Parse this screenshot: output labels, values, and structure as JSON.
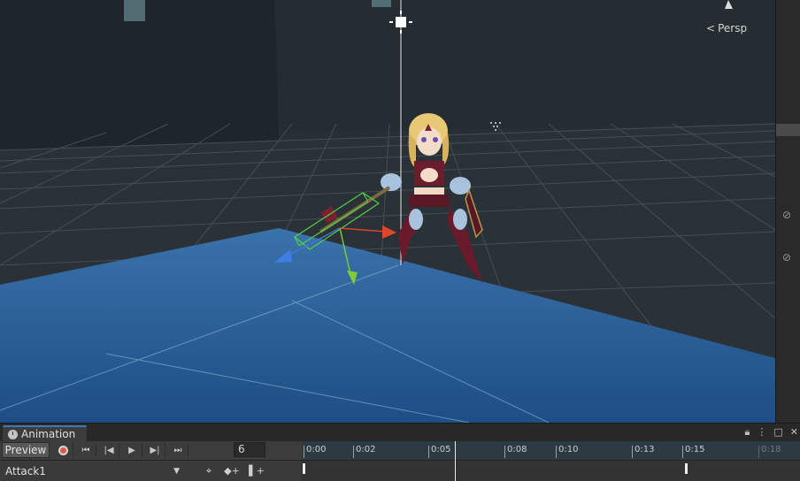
{
  "scene": {
    "camera_mode": "Persp",
    "icons": [
      "light-icon",
      "bone-gizmo-icon",
      "hand-icon"
    ]
  },
  "right_panel": {
    "icons": [
      "visibility-off-icon",
      "visibility-off-icon"
    ]
  },
  "animation": {
    "tab_label": "Animation",
    "window_icons": [
      "lock-icon",
      "menu-dots-icon",
      "maximize-icon",
      "close-icon"
    ],
    "toolbar": {
      "preview_label": "Preview",
      "buttons": [
        "record-button",
        "first-key-button",
        "prev-key-button",
        "play-button",
        "next-key-button",
        "last-key-button"
      ],
      "frame_value": "6"
    },
    "clip_name": "Attack1",
    "row_buttons": [
      "add-keyframe-filter-button",
      "add-keyframe-button",
      "add-event-button"
    ],
    "timeline": {
      "ticks": [
        "0:00",
        "0:02",
        "0:05",
        "0:08",
        "0:10",
        "0:13",
        "0:15",
        "0:18"
      ],
      "current_time_frame": 6
    },
    "colors": {
      "accent": "#3a79bb",
      "record": "#e05a4a",
      "ruler_bg": "#2d3a42"
    }
  }
}
